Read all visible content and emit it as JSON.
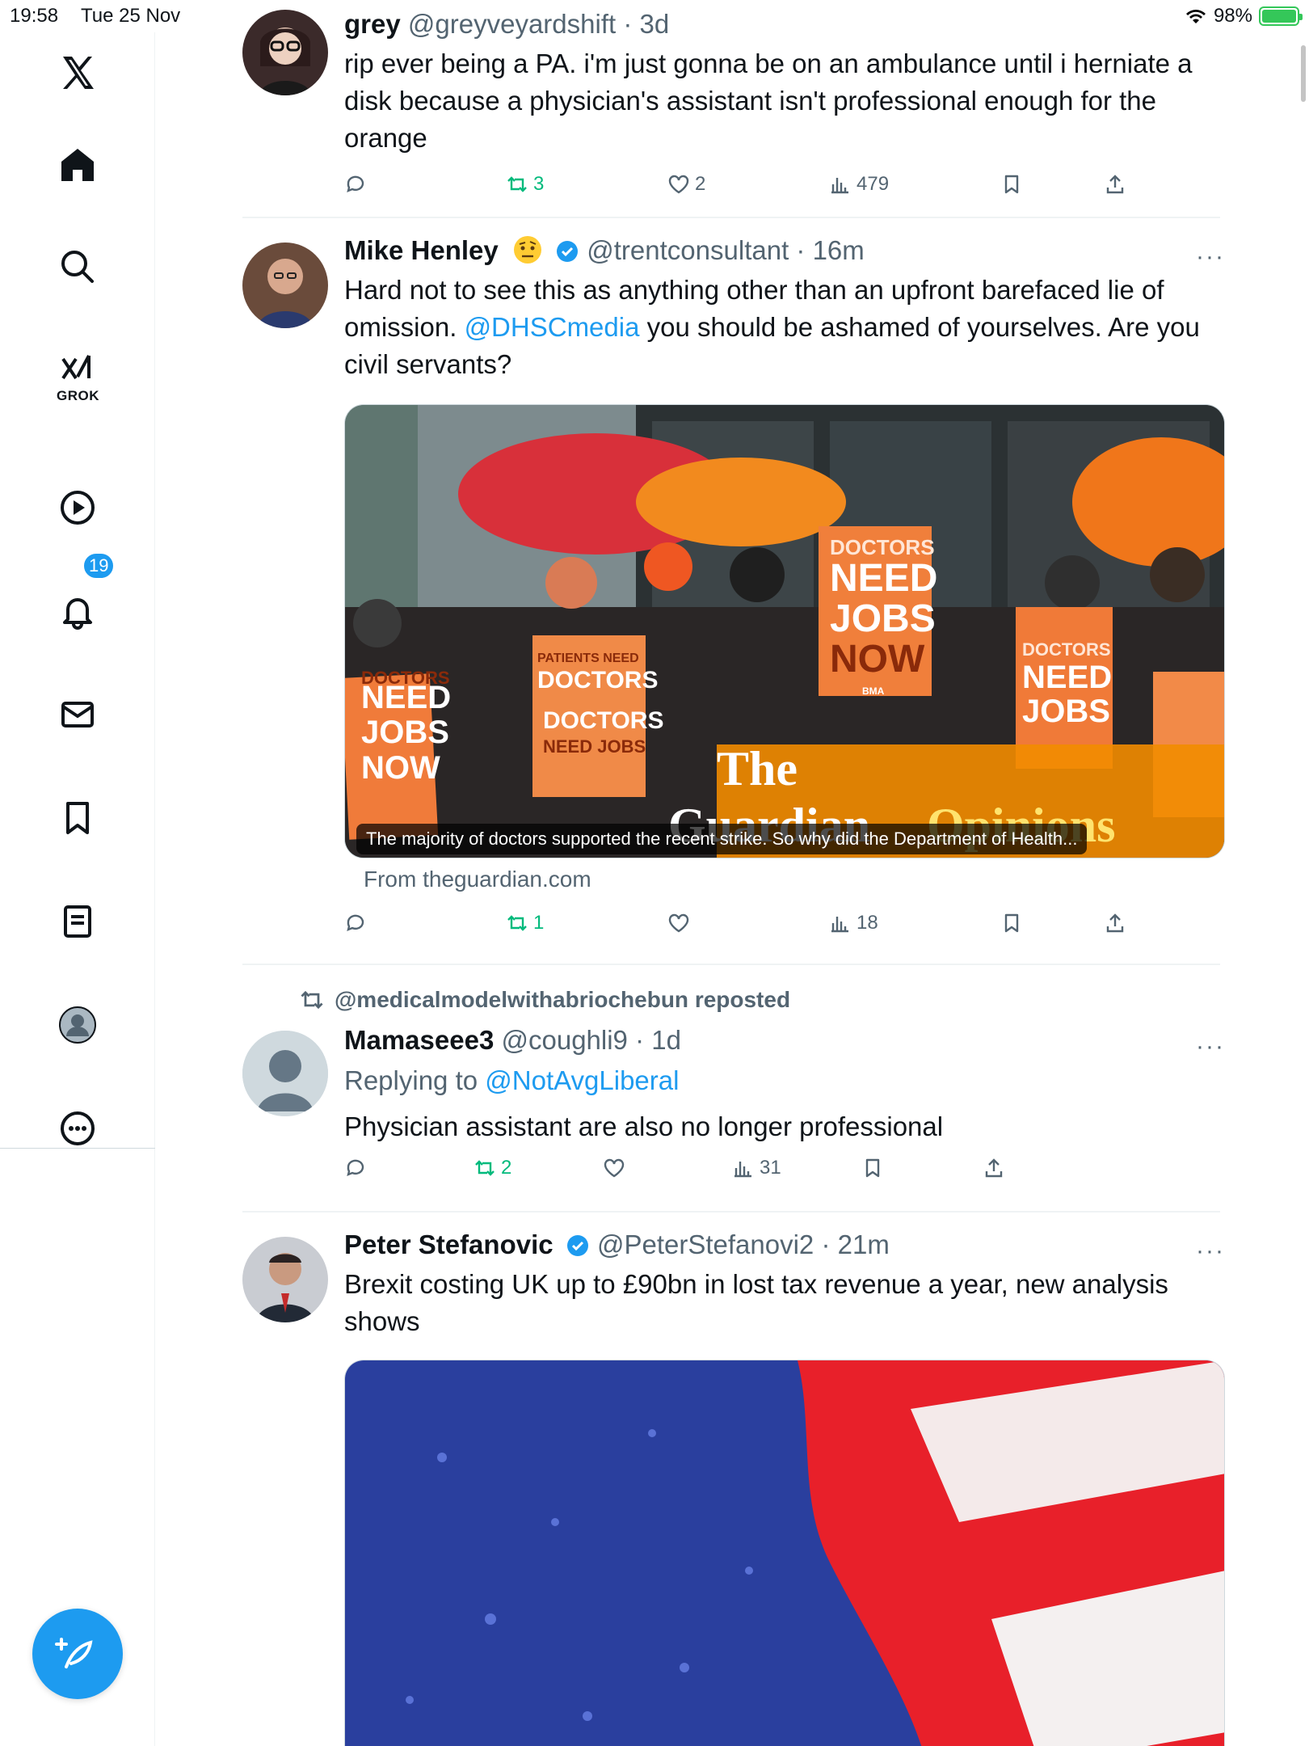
{
  "status_bar": {
    "time": "19:58",
    "date": "Tue 25 Nov",
    "battery": "98%"
  },
  "sidebar": {
    "grok_label": "GROK",
    "notifications_count": "19"
  },
  "tweets": [
    {
      "name": "grey",
      "handle": "@greyveyardshift",
      "time": "3d",
      "text": "rip ever being a PA. i'm just gonna be on an ambulance until i herniate a disk because a physician's assistant isn't professional enough for the orange",
      "reposts": "3",
      "likes": "2",
      "views": "479"
    },
    {
      "name": "Mike Henley",
      "handle": "@trentconsultant",
      "time": "16m",
      "text_before": "Hard not to see this as anything other than an upfront barefaced lie of omission. ",
      "mention": "@DHSCmedia",
      "text_after": " you should be ashamed of yourselves. Are you civil servants?",
      "media_caption": "The majority of doctors supported the recent strike. So why did the Department of Health...",
      "media_source": "From theguardian.com",
      "image_text": {
        "sign1": [
          "DOCTORS",
          "NEED",
          "JOBS",
          "NOW"
        ],
        "sign2_top": "PATIENTS NEED",
        "sign2_mid": "DOCTORS",
        "sign2_low": [
          "DOCTORS",
          "NEED JOBS"
        ],
        "bma": "BMA",
        "brand1": "The",
        "brand2": "Guardian",
        "brand3": "Opinions"
      },
      "reposts": "1",
      "likes": "",
      "views": "18"
    },
    {
      "repost_by": "@medicalmodelwithabriochebun reposted",
      "name": "Mamaseee3",
      "handle": "@coughli9",
      "time": "1d",
      "replying_label": "Replying to ",
      "replying_to": "@NotAvgLiberal",
      "text": "Physician assistant are also no longer professional",
      "reposts": "2",
      "likes": "",
      "views": "31"
    },
    {
      "name": "Peter Stefanovic",
      "handle": "@PeterStefanovi2",
      "time": "21m",
      "text": "Brexit costing UK up to £90bn in lost tax revenue a year, new analysis shows"
    }
  ],
  "colors": {
    "accent": "#1d9bf0",
    "repost_green": "#00ba7c",
    "muted": "#536471",
    "text": "#0f1419"
  }
}
